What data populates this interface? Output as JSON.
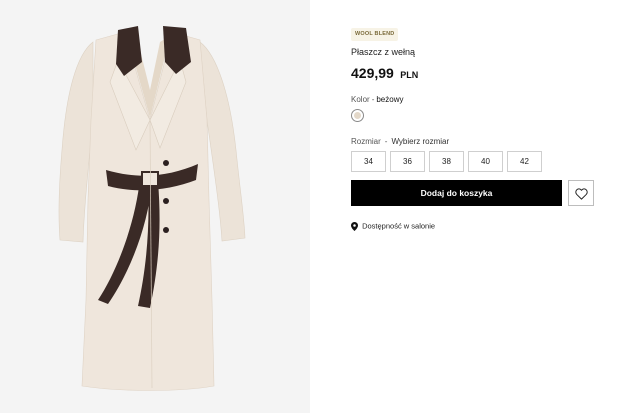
{
  "product": {
    "tag": "WOOL BLEND",
    "name": "Płaszcz z wełną",
    "price_value": "429,99",
    "price_currency": "PLN"
  },
  "color": {
    "label": "Kolor",
    "separator": "-",
    "value": "beżowy",
    "swatch_hex": "#e3d8c9"
  },
  "size": {
    "label": "Rozmiar",
    "separator": "-",
    "prompt": "Wybierz rozmiar",
    "options": [
      "34",
      "36",
      "38",
      "40",
      "42"
    ]
  },
  "actions": {
    "add_to_cart": "Dodaj do koszyka",
    "wishlist_icon": "heart-icon"
  },
  "availability": {
    "icon": "map-pin-icon",
    "label": "Dostępność w salonie"
  },
  "colors": {
    "accent_button": "#000000",
    "tag_text": "#7a6a3a",
    "tag_bg": "#f7f3e6",
    "coat_fabric": "#efe6dc",
    "coat_leather": "#3a2a26"
  }
}
